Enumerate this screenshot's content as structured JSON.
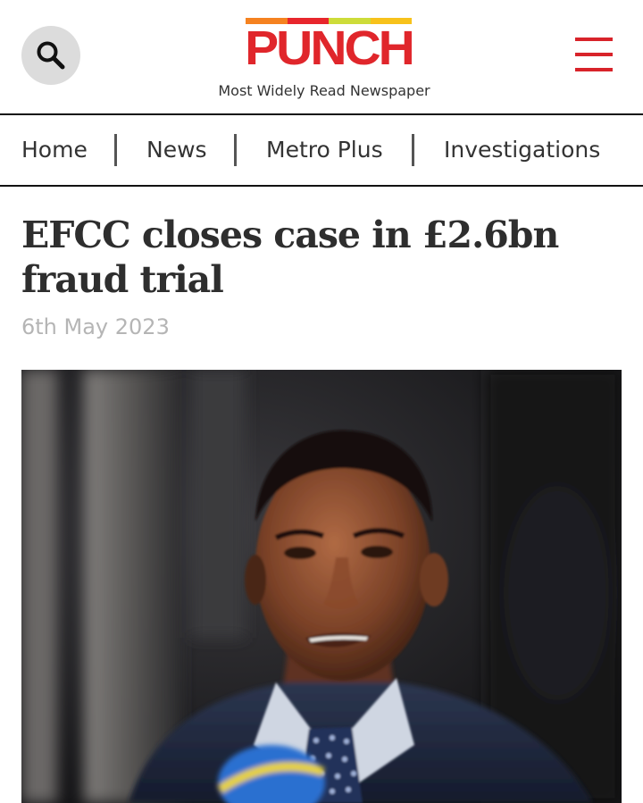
{
  "header": {
    "logo_text": "PUNCH",
    "tagline": "Most Widely Read Newspaper",
    "colors": {
      "brand_red": "#e0262b",
      "stripe": [
        "#f58220",
        "#e8262c",
        "#cddc39",
        "#f7c21b"
      ],
      "menu": "#d8232a"
    },
    "search_icon": "search-icon",
    "menu_icon": "hamburger-menu-icon"
  },
  "nav": {
    "items": [
      {
        "label": "Home"
      },
      {
        "label": "News"
      },
      {
        "label": "Metro Plus"
      },
      {
        "label": "Investigations"
      }
    ]
  },
  "article": {
    "title": "EFCC closes case in £2.6bn fraud trial",
    "date": "6th May 2023"
  }
}
